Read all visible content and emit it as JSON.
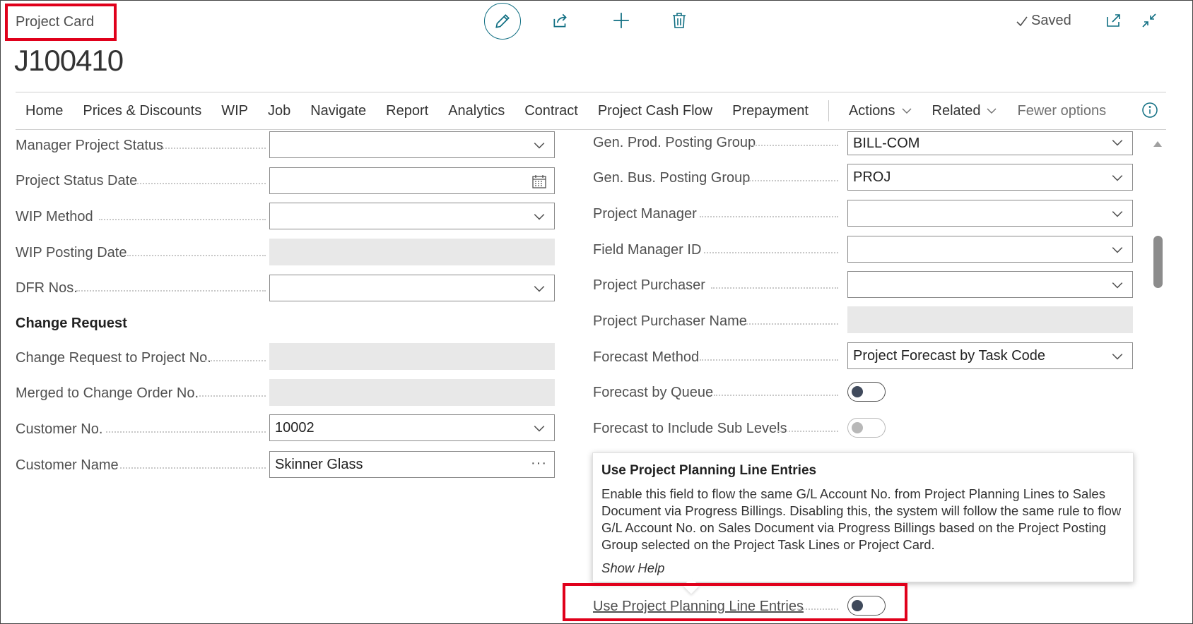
{
  "header": {
    "page_type": "Project Card",
    "record_title": "J100410",
    "saved_label": "Saved"
  },
  "action_bar": {
    "items": [
      "Home",
      "Prices & Discounts",
      "WIP",
      "Job",
      "Navigate",
      "Report",
      "Analytics",
      "Contract",
      "Project Cash Flow",
      "Prepayment"
    ],
    "actions_label": "Actions",
    "related_label": "Related",
    "fewer_label": "Fewer options"
  },
  "left_fields": {
    "manager_project_status": {
      "label": "Manager Project Status",
      "value": ""
    },
    "project_status_date": {
      "label": "Project Status Date",
      "value": ""
    },
    "wip_method": {
      "label": "WIP Method",
      "value": ""
    },
    "wip_posting_date": {
      "label": "WIP Posting Date",
      "value": ""
    },
    "dfr_nos": {
      "label": "DFR Nos.",
      "value": ""
    },
    "change_request_section": "Change Request",
    "change_request_to_project": {
      "label": "Change Request to Project No.",
      "value": ""
    },
    "merged_to_change_order": {
      "label": "Merged to Change Order No.",
      "value": ""
    },
    "customer_no": {
      "label": "Customer No.",
      "value": "10002"
    },
    "customer_name": {
      "label": "Customer Name",
      "value": "Skinner Glass"
    }
  },
  "right_fields": {
    "gen_prod_posting_group": {
      "label": "Gen. Prod. Posting Group",
      "value": "BILL-COM"
    },
    "gen_bus_posting_group": {
      "label": "Gen. Bus. Posting Group",
      "value": "PROJ"
    },
    "project_manager": {
      "label": "Project Manager",
      "value": ""
    },
    "field_manager_id": {
      "label": "Field Manager ID",
      "value": ""
    },
    "project_purchaser": {
      "label": "Project Purchaser",
      "value": ""
    },
    "project_purchaser_name": {
      "label": "Project Purchaser Name",
      "value": ""
    },
    "forecast_method": {
      "label": "Forecast Method",
      "value": "Project Forecast by Task Code"
    },
    "forecast_by_queue": {
      "label": "Forecast by Queue",
      "value": "off"
    },
    "forecast_include_sub_levels": {
      "label": "Forecast to Include Sub Levels",
      "value": "off"
    },
    "use_project_planning_line_entries": {
      "label": "Use Project Planning Line Entries",
      "value": "off"
    }
  },
  "tooltip": {
    "title": "Use Project Planning Line Entries",
    "body": "Enable this field to flow the same G/L Account No. from Project Planning Lines to Sales Document via Progress Billings. Disabling this, the system will follow the same rule to flow G/L Account No. on Sales Document via Progress Billings based on the Project Posting Group selected on the Project Task Lines or Project Card.",
    "link": "Show Help"
  },
  "colors": {
    "accent": "#0f6e82",
    "highlight_red": "#e0001b",
    "readonly_fill": "#e8e8e8"
  }
}
